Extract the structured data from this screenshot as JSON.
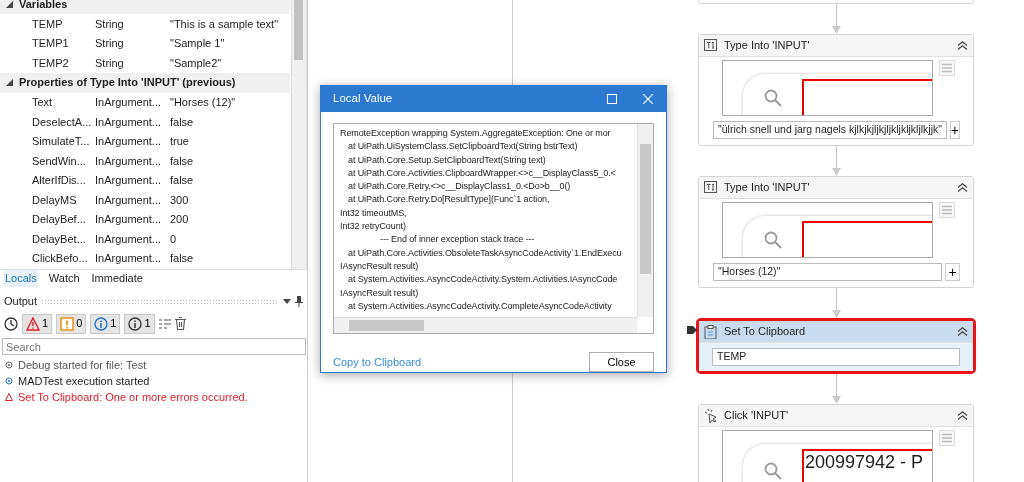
{
  "locals": {
    "sections": [
      {
        "title": "Variables",
        "expanded": true,
        "rows": [
          {
            "name": "TEMP",
            "type": "String",
            "value": "\"This is a sample text\""
          },
          {
            "name": "TEMP1",
            "type": "String",
            "value": "\"Sample 1\""
          },
          {
            "name": "TEMP2",
            "type": "String",
            "value": "\"Sample2\""
          }
        ]
      },
      {
        "title": "Properties of Type Into 'INPUT' (previous)",
        "expanded": true,
        "rows": [
          {
            "name": "Text",
            "type": "InArgument...",
            "value": "\"Horses (12)\""
          },
          {
            "name": "DeselectA...",
            "type": "InArgument...",
            "value": "false"
          },
          {
            "name": "SimulateT...",
            "type": "InArgument...",
            "value": "true"
          },
          {
            "name": "SendWin...",
            "type": "InArgument...",
            "value": "false"
          },
          {
            "name": "AlterIfDis...",
            "type": "InArgument...",
            "value": "false"
          },
          {
            "name": "DelayMS",
            "type": "InArgument...",
            "value": "300"
          },
          {
            "name": "DelayBef...",
            "type": "InArgument...",
            "value": "200"
          },
          {
            "name": "DelayBet...",
            "type": "InArgument...",
            "value": "0"
          },
          {
            "name": "ClickBefo...",
            "type": "InArgument...",
            "value": "false"
          }
        ]
      }
    ]
  },
  "bottom_tabs": [
    {
      "label": "Locals",
      "selected": true
    },
    {
      "label": "Watch",
      "selected": false
    },
    {
      "label": "Immediate",
      "selected": false
    }
  ],
  "output": {
    "title": "Output",
    "filters": [
      {
        "kind": "error",
        "count": "1"
      },
      {
        "kind": "warning",
        "count": "0"
      },
      {
        "kind": "info",
        "count": "1"
      },
      {
        "kind": "trace",
        "count": "1"
      }
    ],
    "search": {
      "placeholder": "Search"
    },
    "messages": [
      {
        "kind": "trace",
        "text": "Debug started for file: Test"
      },
      {
        "kind": "info",
        "text": "MADTest execution started"
      },
      {
        "kind": "error",
        "text": "Set To Clipboard: One or more errors occurred."
      }
    ]
  },
  "dialog": {
    "title": "Local Value",
    "lines": [
      {
        "kind": "head",
        "text": "RemoteException wrapping System.AggregateException: One or mor"
      },
      {
        "kind": "frame",
        "text": "at UiPath.UiSystemClass.SetClipboardText(String bstrText)"
      },
      {
        "kind": "frame",
        "text": "at UiPath.Core.Setup.SetClipboardText(String text)"
      },
      {
        "kind": "frame",
        "text": "at UiPath.Core.Activities.ClipboardWrapper.<>c__DisplayClass5_0.<"
      },
      {
        "kind": "frame",
        "text": "at UiPath.Core.Retry.<>c__DisplayClass1_0.<Do>b__0()"
      },
      {
        "kind": "frame",
        "text": "at UiPath.Core.Retry.Do[ResultType](Func`1 action,"
      },
      {
        "kind": "head",
        "text": "Int32 timeoutMS,"
      },
      {
        "kind": "head",
        "text": "Int32 retryCount)"
      },
      {
        "kind": "separator",
        "text": "--- End of inner exception stack trace ---"
      },
      {
        "kind": "frame",
        "text": "at UiPath.Core.Activities.ObsoleteTaskAsyncCodeActivity`1.EndExecu"
      },
      {
        "kind": "head",
        "text": "IAsyncResult result)"
      },
      {
        "kind": "frame",
        "text": "at System.Activities.AsyncCodeActivity.System.Activities.IAsyncCode"
      },
      {
        "kind": "head",
        "text": "IAsyncResult result)"
      },
      {
        "kind": "frame",
        "text": "at System.Activities.AsyncCodeActivity.CompleteAsyncCodeActivity"
      }
    ],
    "link": "Copy to Clipboard",
    "button": "Close"
  },
  "activities": [
    {
      "kind": "type-into",
      "title": "Type Into 'INPUT'",
      "text": "\"ülrich snell und jarg nagels kjlkjkjljkjljkljkljkljlkjjk\"",
      "add_button": "+",
      "selected": false
    },
    {
      "kind": "type-into",
      "title": "Type Into 'INPUT'",
      "text": "\"Horses (12)\"",
      "add_button": "+",
      "selected": false
    },
    {
      "kind": "set-clipboard",
      "title": "Set To Clipboard",
      "text": "TEMP",
      "selected": true
    },
    {
      "kind": "click",
      "title": "Click 'INPUT'",
      "preview_text": "200997942 - P",
      "selected": false
    }
  ]
}
